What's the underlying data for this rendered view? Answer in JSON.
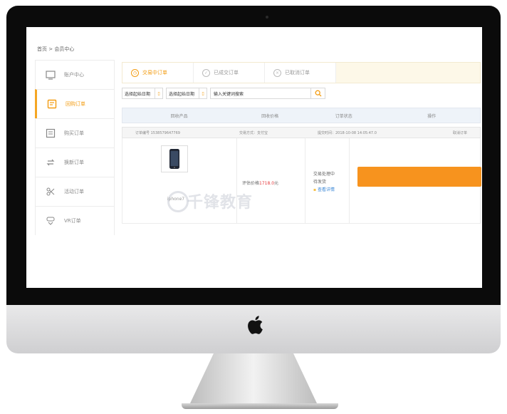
{
  "breadcrumb": "首页 > 会员中心",
  "sidebar": {
    "items": [
      {
        "label": "账户中心",
        "icon": "monitor-icon"
      },
      {
        "label": "回购订单",
        "icon": "order-list-icon",
        "active": true
      },
      {
        "label": "购买订单",
        "icon": "cart-list-icon"
      },
      {
        "label": "换新订单",
        "icon": "exchange-icon"
      },
      {
        "label": "活动订单",
        "icon": "scissors-icon"
      },
      {
        "label": "VR订单",
        "icon": "vr-icon"
      }
    ]
  },
  "tabs": [
    {
      "label": "交易中订单",
      "icon": "clock-icon",
      "active": true
    },
    {
      "label": "已成交订单",
      "icon": "check-circle-icon"
    },
    {
      "label": "已取消订单",
      "icon": "x-circle-icon"
    }
  ],
  "filters": {
    "start_date": "选择起始日期",
    "end_date": "选择起始日期",
    "search_value": "输入关键词搜索"
  },
  "table": {
    "headers": [
      "回收产品",
      "回收价格",
      "订单状态",
      "操作"
    ]
  },
  "order": {
    "number": "订单编号 1538579647769",
    "payment": "交易方式：支付宝",
    "submit_time": "提交时间：2018-10-08 14:05:47.0",
    "cancel": "取消订单",
    "product": "iphone7",
    "price_label": "评估价格",
    "price_value": "1718.0",
    "price_unit": "元",
    "status_line1": "交易处理中",
    "status_line2": "待发货",
    "detail_link": "查看详情"
  },
  "watermark": "千锋教育",
  "colors": {
    "accent": "#f7931e",
    "price_red": "#e4393c",
    "link_blue": "#3a87d6"
  }
}
